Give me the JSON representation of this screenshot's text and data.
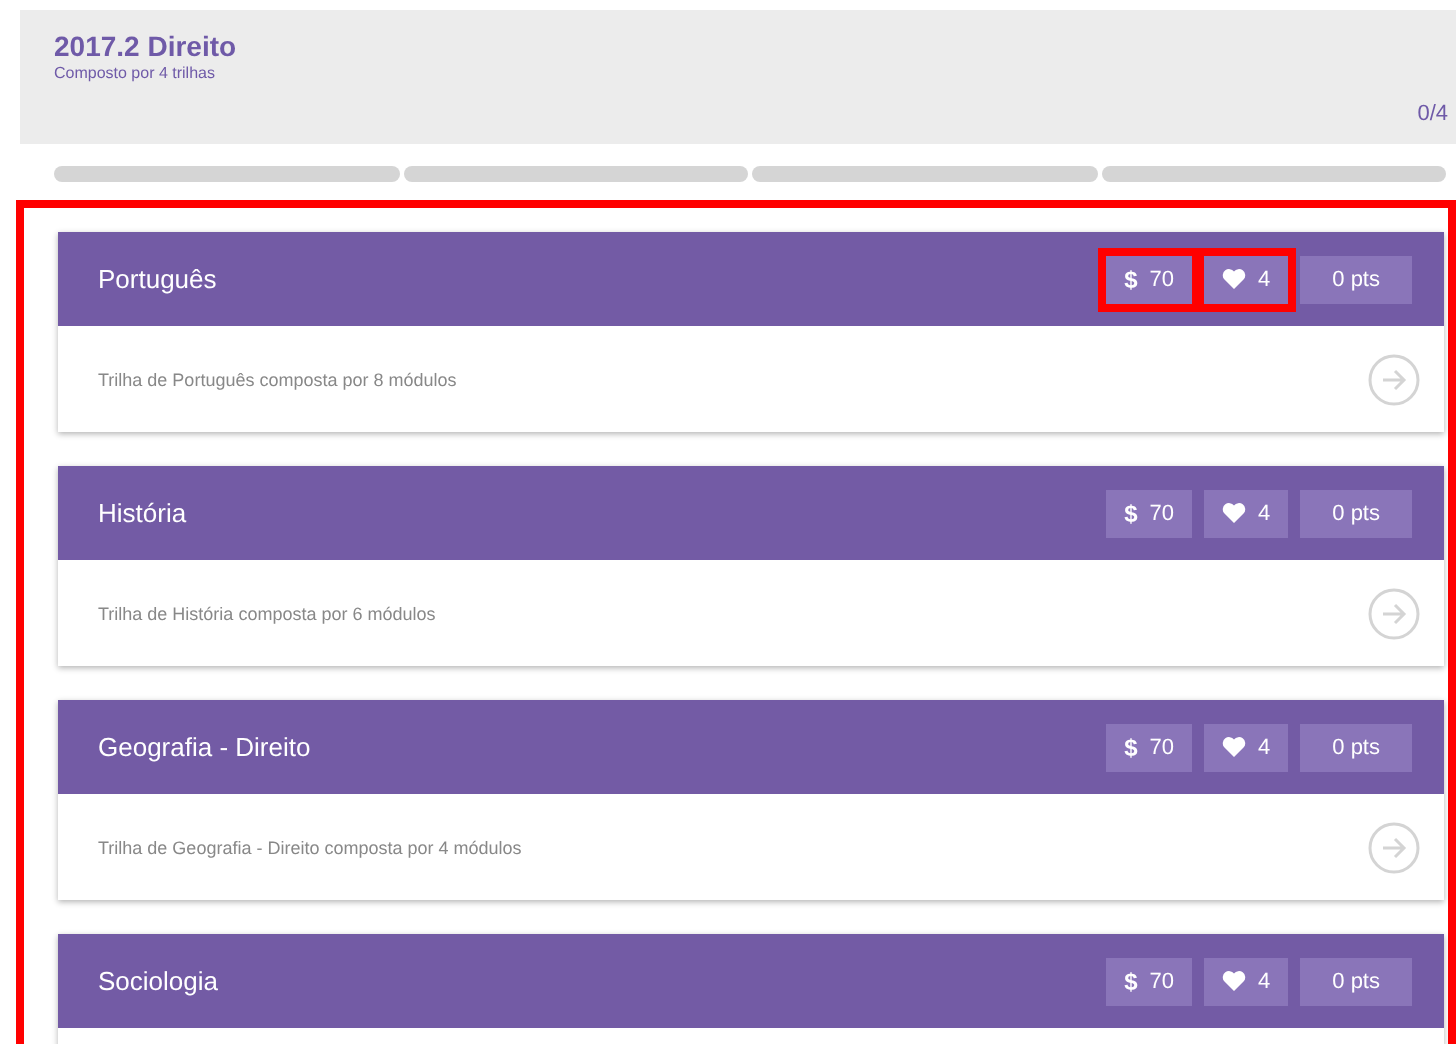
{
  "course": {
    "title": "2017.2 Direito",
    "subtitle": "Composto por 4 trilhas",
    "progress_label": "0/4",
    "segments": [
      {
        "level": 0
      },
      {
        "level": 0
      },
      {
        "level": 0
      },
      {
        "level": 0
      }
    ]
  },
  "tracks_highlighted": true,
  "tracks": [
    {
      "name": "Português",
      "description": "Trilha de Português composta por 8 módulos",
      "stats": [
        {
          "kind": "coins",
          "icon": "$",
          "value": "70",
          "highlighted": true
        },
        {
          "kind": "lives",
          "value": "4",
          "highlighted": true
        },
        {
          "kind": "points",
          "value": "0 pts",
          "highlighted": false
        }
      ]
    },
    {
      "name": "História",
      "description": "Trilha de História composta por 6 módulos",
      "stats": [
        {
          "kind": "coins",
          "icon": "$",
          "value": "70",
          "highlighted": false
        },
        {
          "kind": "lives",
          "value": "4",
          "highlighted": false
        },
        {
          "kind": "points",
          "value": "0 pts",
          "highlighted": false
        }
      ]
    },
    {
      "name": "Geografia - Direito",
      "description": "Trilha de Geografia - Direito composta por 4 módulos",
      "stats": [
        {
          "kind": "coins",
          "icon": "$",
          "value": "70",
          "highlighted": false
        },
        {
          "kind": "lives",
          "value": "4",
          "highlighted": false
        },
        {
          "kind": "points",
          "value": "0 pts",
          "highlighted": false
        }
      ]
    },
    {
      "name": "Sociologia",
      "stats": [
        {
          "kind": "coins",
          "icon": "$",
          "value": "70",
          "highlighted": false
        },
        {
          "kind": "lives",
          "value": "4",
          "highlighted": false
        },
        {
          "kind": "points",
          "value": "0 pts",
          "highlighted": false
        }
      ]
    }
  ]
}
